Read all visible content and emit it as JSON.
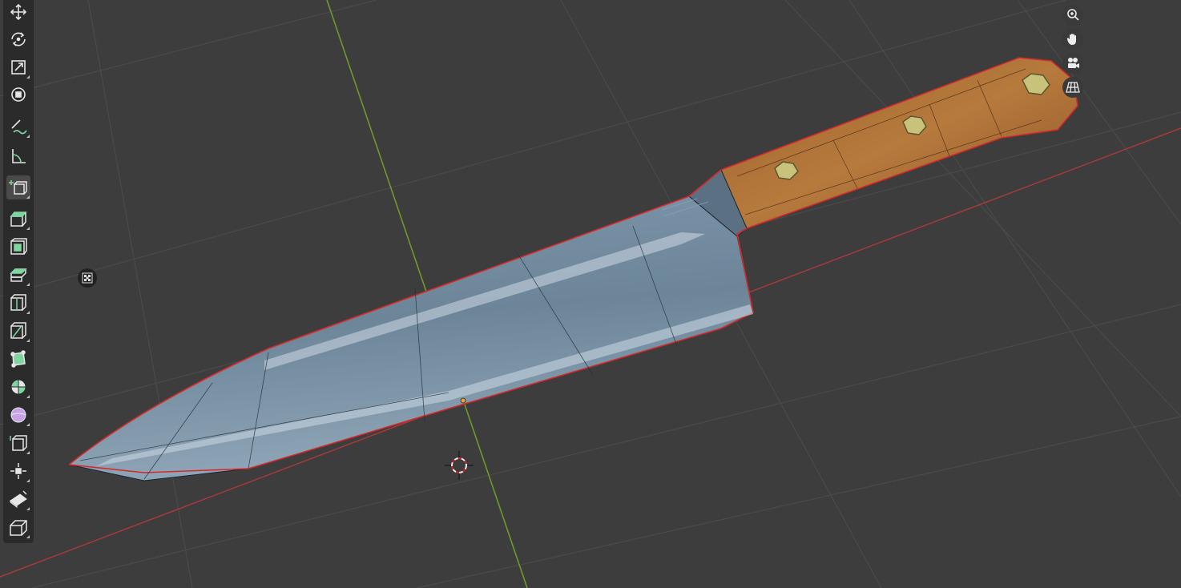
{
  "viewport": {
    "background": "#3d3d3d",
    "grid_color": "#4f4f4f",
    "x_axis_color": "#b23a3a",
    "y_axis_color": "#6f9a2d",
    "object": "chef-knife",
    "selection_outline_color": "#d62a2a"
  },
  "toolbar": {
    "tools": [
      {
        "name": "move-tool",
        "icon": "move-icon"
      },
      {
        "name": "rotate-tool",
        "icon": "rotate-icon"
      },
      {
        "name": "scale-tool",
        "icon": "scale-icon"
      },
      {
        "name": "transform-tool",
        "icon": "transform-icon"
      },
      {
        "name": "annotate-tool",
        "icon": "annotate-icon"
      },
      {
        "name": "measure-tool",
        "icon": "measure-icon"
      },
      {
        "name": "add-cube-tool",
        "icon": "add-cube-icon"
      },
      {
        "name": "extrude-tool",
        "icon": "extrude-icon"
      },
      {
        "name": "inset-tool",
        "icon": "inset-icon"
      },
      {
        "name": "bevel-tool",
        "icon": "bevel-icon"
      },
      {
        "name": "loop-cut-tool",
        "icon": "loop-cut-icon"
      },
      {
        "name": "knife-tool",
        "icon": "knife-icon"
      },
      {
        "name": "poly-build-tool",
        "icon": "poly-build-icon"
      },
      {
        "name": "spin-tool",
        "icon": "spin-icon"
      },
      {
        "name": "smooth-tool",
        "icon": "smooth-icon"
      },
      {
        "name": "shear-tool",
        "icon": "shear-icon"
      },
      {
        "name": "shrink-fatten-tool",
        "icon": "shrink-fatten-icon"
      },
      {
        "name": "edge-slide-tool",
        "icon": "edge-slide-icon"
      },
      {
        "name": "rip-tool",
        "icon": "rip-icon"
      }
    ]
  },
  "navigation": {
    "buttons": [
      {
        "name": "zoom-button",
        "icon": "zoom-icon"
      },
      {
        "name": "pan-button",
        "icon": "hand-icon"
      },
      {
        "name": "camera-view-button",
        "icon": "camera-icon"
      },
      {
        "name": "perspective-toggle-button",
        "icon": "grid-icon"
      }
    ]
  }
}
